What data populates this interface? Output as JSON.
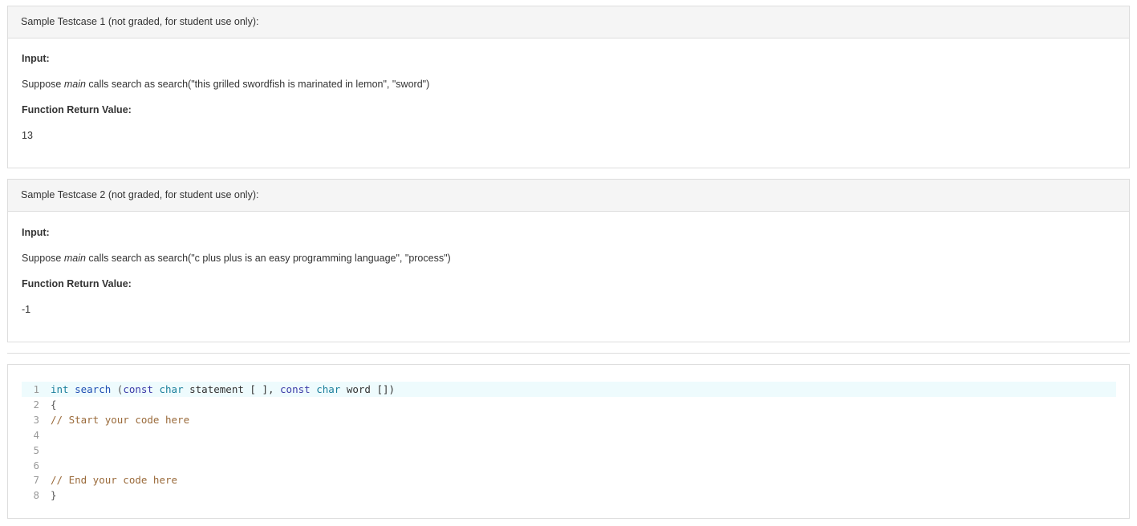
{
  "testcases": [
    {
      "header": "Sample Testcase 1 (not graded, for student use only):",
      "input_label": "Input:",
      "input_prefix": "Suppose ",
      "input_main": "main",
      "input_suffix": " calls search as search(\"this grilled swordfish is marinated in lemon\", \"sword\")",
      "return_label": "Function Return Value:",
      "return_value": "13"
    },
    {
      "header": "Sample Testcase 2 (not graded, for student use only):",
      "input_label": "Input:",
      "input_prefix": "Suppose ",
      "input_main": "main",
      "input_suffix": " calls search as search(\"c plus plus is an easy programming language\", \"process\")",
      "return_label": "Function Return Value:",
      "return_value": "-1"
    }
  ],
  "editor": {
    "lines": [
      {
        "num": "1",
        "text": "int search (const char statement [ ], const char word [])"
      },
      {
        "num": "2",
        "text": "{"
      },
      {
        "num": "3",
        "text": "// Start your code here"
      },
      {
        "num": "4",
        "text": ""
      },
      {
        "num": "5",
        "text": ""
      },
      {
        "num": "6",
        "text": ""
      },
      {
        "num": "7",
        "text": "// End your code here"
      },
      {
        "num": "8",
        "text": "}"
      }
    ],
    "line1_tokens": [
      "int",
      " ",
      "search",
      " (",
      "const",
      " ",
      "char",
      " statement [ ], ",
      "const",
      " ",
      "char",
      " word [])"
    ]
  }
}
